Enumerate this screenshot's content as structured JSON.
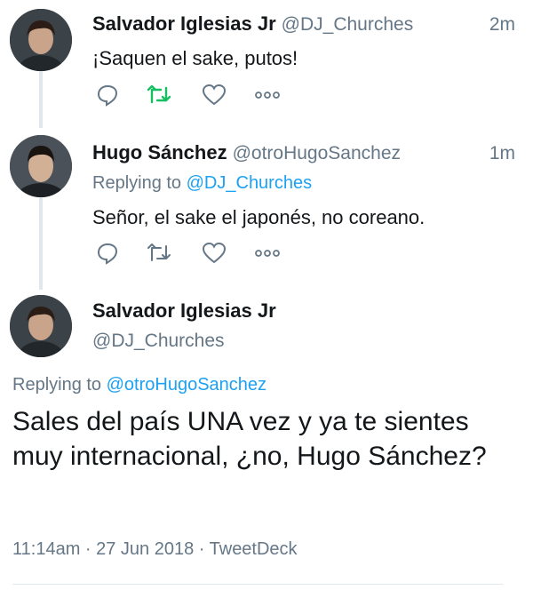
{
  "tweets": [
    {
      "name": "Salvador Iglesias Jr",
      "handle": "@DJ_Churches",
      "time": "2m",
      "text": "¡Saquen el sake, putos!",
      "retweeted": true
    },
    {
      "name": "Hugo Sánchez",
      "handle": "@otroHugoSanchez",
      "time": "1m",
      "replying_prefix": "Replying to",
      "replying_to": "@DJ_Churches",
      "text": "Señor, el sake el japonés, no coreano.",
      "retweeted": false
    }
  ],
  "main_tweet": {
    "name": "Salvador Iglesias Jr",
    "handle": "@DJ_Churches",
    "replying_prefix": "Replying to",
    "replying_to": "@otroHugoSanchez",
    "text": "Sales del país UNA vez y ya te sientes muy internacional, ¿no, Hugo Sánchez?",
    "timestamp": "11:14am · 27 Jun 2018 · TweetDeck"
  },
  "icons": {
    "reply": "reply-icon",
    "retweet": "retweet-icon",
    "like": "heart-icon",
    "more": "more-dots-icon"
  },
  "colors": {
    "retweet_active": "#17bf63",
    "action_default": "#657786",
    "link": "#1da1f2",
    "thread_line": "#e1e8ed"
  }
}
